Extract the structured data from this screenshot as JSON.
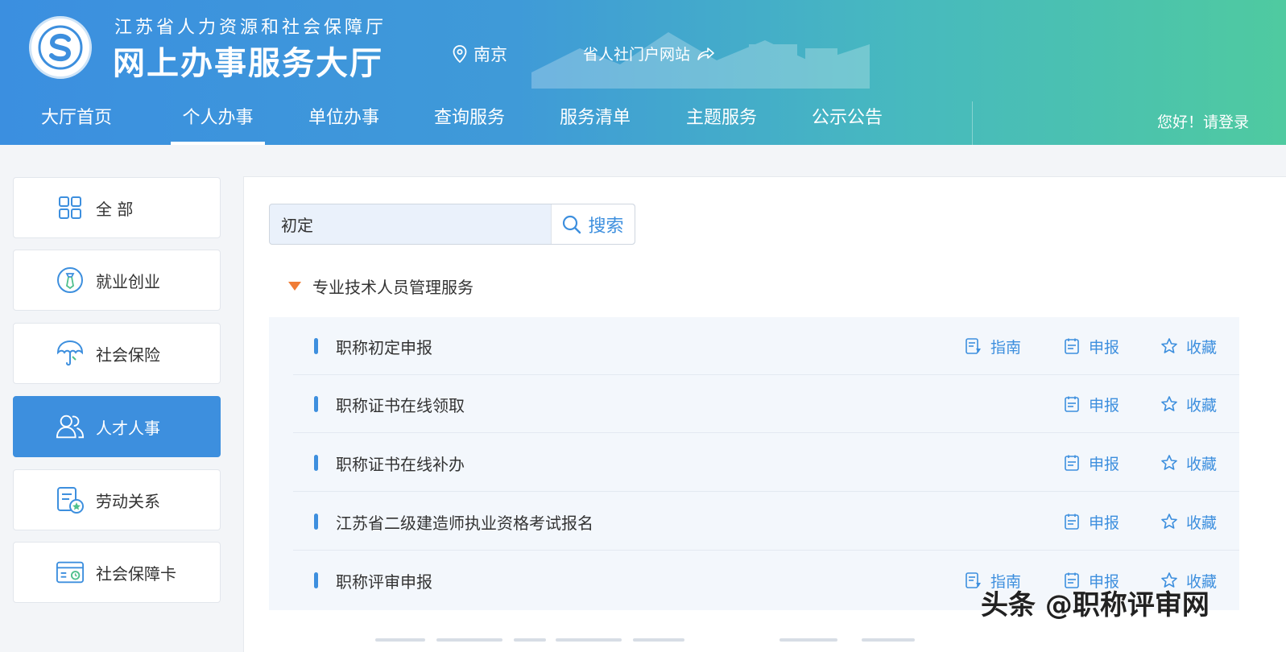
{
  "header": {
    "org_name": "江苏省人力资源和社会保障厅",
    "hall_title": "网上办事服务大厅",
    "location": "南京",
    "portal_link": "省人社门户网站",
    "login_text": "您好！请登录",
    "nav": [
      "大厅首页",
      "个人办事",
      "单位办事",
      "查询服务",
      "服务清单",
      "主题服务",
      "公示公告"
    ],
    "active_nav": "个人办事"
  },
  "sidebar": {
    "items": [
      {
        "label": "全 部",
        "icon": "grid-icon"
      },
      {
        "label": "就业创业",
        "icon": "employment-icon"
      },
      {
        "label": "社会保险",
        "icon": "umbrella-icon"
      },
      {
        "label": "人才人事",
        "icon": "people-icon"
      },
      {
        "label": "劳动关系",
        "icon": "document-star-icon"
      },
      {
        "label": "社会保障卡",
        "icon": "card-icon"
      }
    ],
    "active": "人才人事"
  },
  "search": {
    "value": "初定",
    "button_label": "搜索"
  },
  "category": {
    "title": "专业技术人员管理服务"
  },
  "actions": {
    "guide": "指南",
    "apply": "申报",
    "favorite": "收藏"
  },
  "services": [
    {
      "name": "职称初定申报",
      "has_guide": true
    },
    {
      "name": "职称证书在线领取",
      "has_guide": false
    },
    {
      "name": "职称证书在线补办",
      "has_guide": false
    },
    {
      "name": "江苏省二级建造师执业资格考试报名",
      "has_guide": false
    },
    {
      "name": "职称评审申报",
      "has_guide": true
    }
  ],
  "watermark": "头条 @职称评审网",
  "colors": {
    "primary": "#3d8fde",
    "header_start": "#3b8fe0",
    "header_end": "#4fcaa0",
    "accent_triangle": "#f07c36"
  }
}
